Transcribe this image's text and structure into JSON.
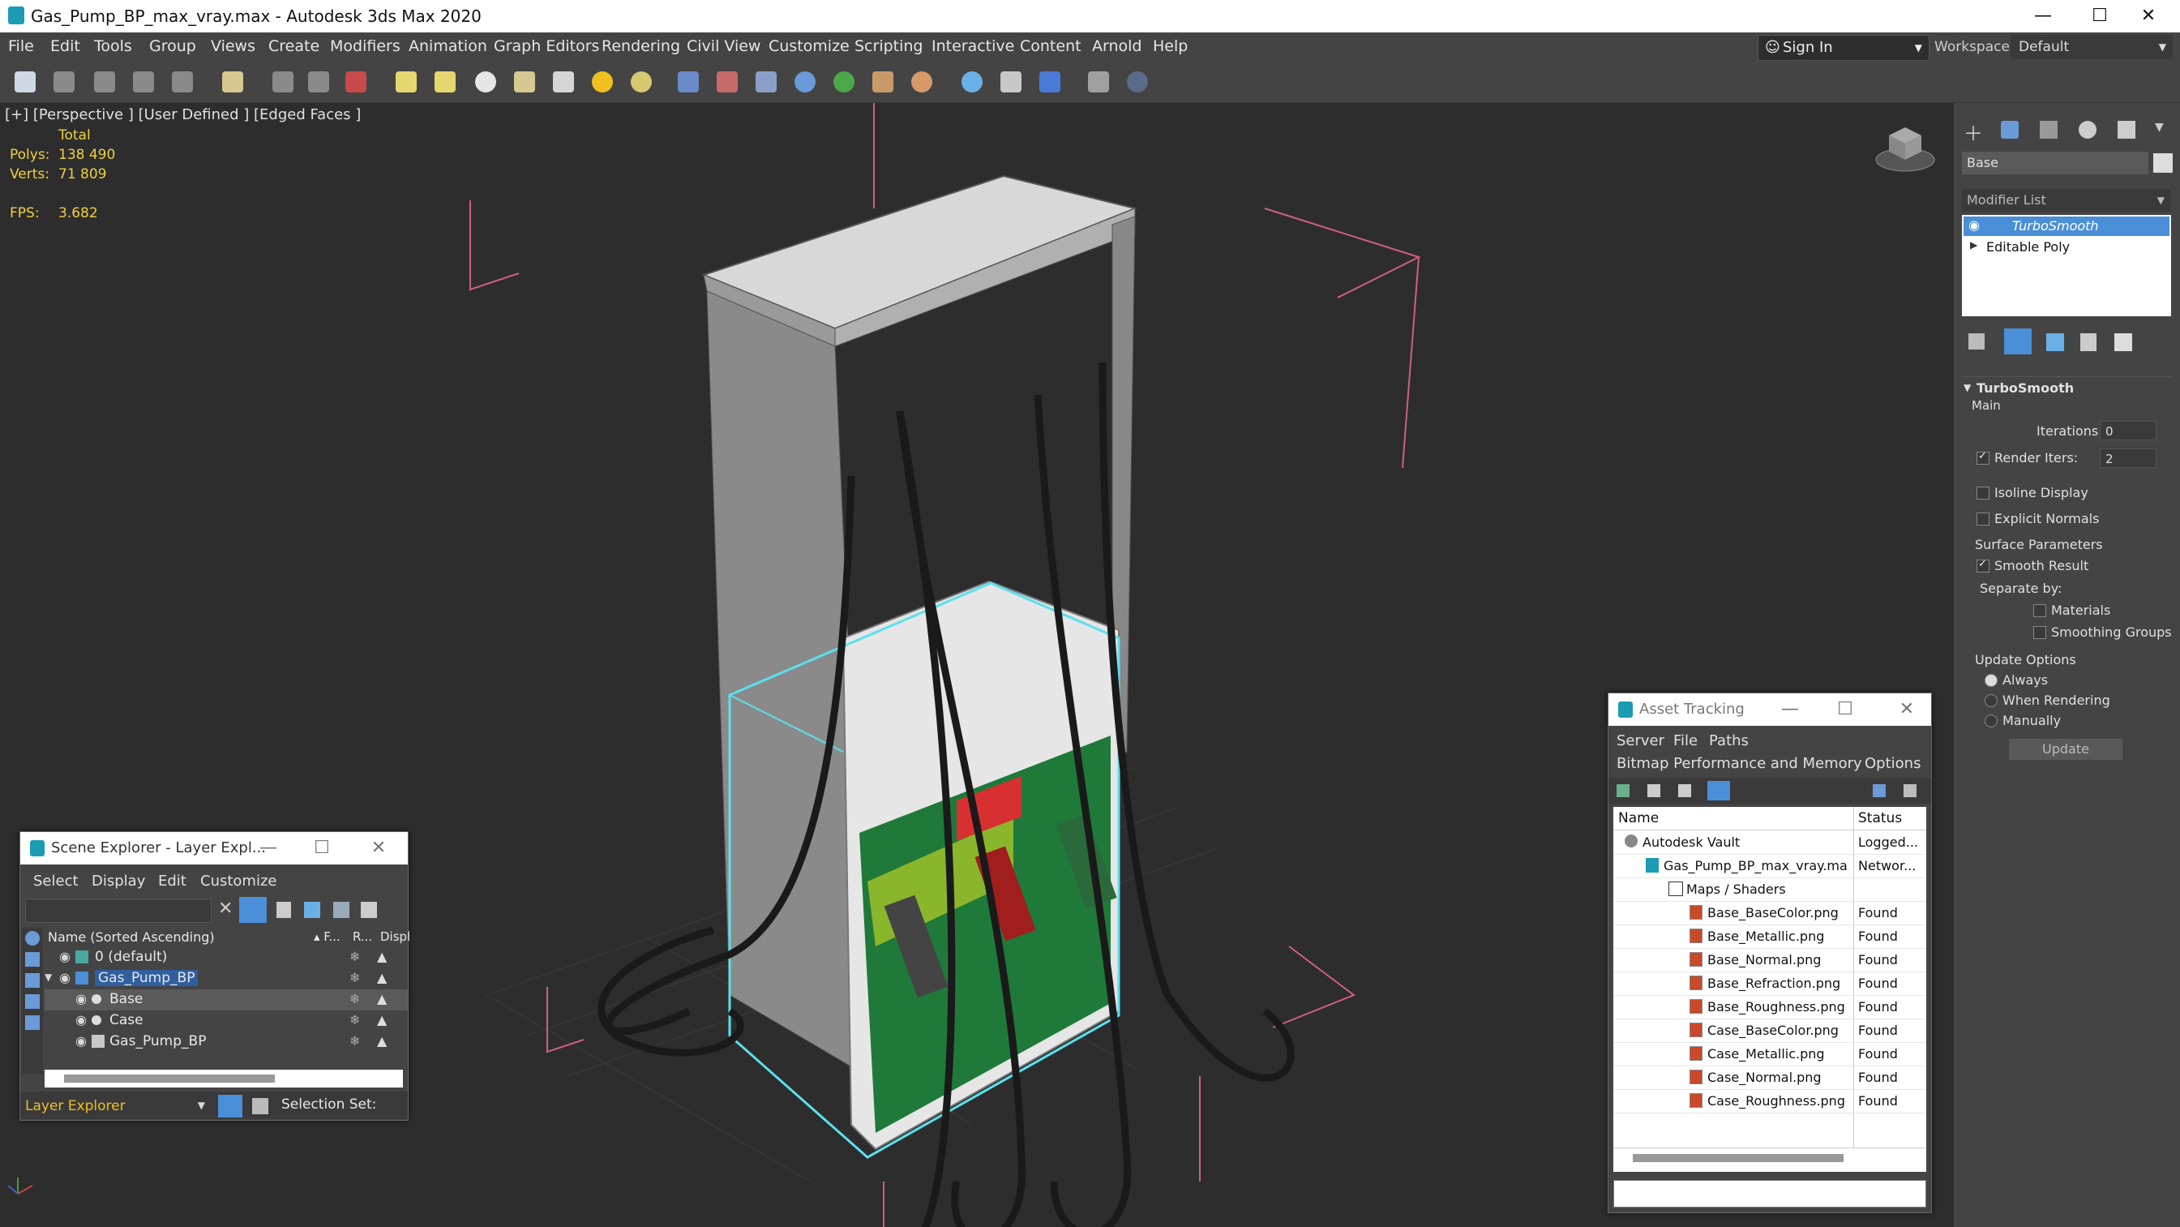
{
  "app": {
    "title": "Gas_Pump_BP_max_vray.max - Autodesk 3ds Max 2020"
  },
  "menu": [
    "File",
    "Edit",
    "Tools",
    "Group",
    "Views",
    "Create",
    "Modifiers",
    "Animation",
    "Graph Editors",
    "Rendering",
    "Civil View",
    "Customize",
    "Scripting",
    "Interactive",
    "Content",
    "Arnold",
    "Help"
  ],
  "account": {
    "sign_in": "Sign In",
    "workspaces_label": "Workspaces:",
    "workspace": "Default"
  },
  "viewport": {
    "label": "[+] [Perspective ] [User Defined ] [Edged Faces ]",
    "stats": {
      "total_label": "Total",
      "polys_label": "Polys:",
      "polys": "138 490",
      "verts_label": "Verts:",
      "verts": "71 809",
      "fps_label": "FPS:",
      "fps": "3.682"
    }
  },
  "command_panel": {
    "object_name": "Base",
    "modifier_list": "Modifier List",
    "stack": [
      "TurboSmooth",
      "Editable Poly"
    ],
    "turbosmooth": {
      "title": "TurboSmooth",
      "main": "Main",
      "iterations_label": "Iterations:",
      "iterations": "0",
      "render_iters_label": "Render Iters:",
      "render_iters": "2",
      "isoline": "Isoline Display",
      "explicit_normals": "Explicit Normals",
      "surface_params": "Surface Parameters",
      "smooth_result": "Smooth Result",
      "separate_by": "Separate by:",
      "materials": "Materials",
      "smoothing_groups": "Smoothing Groups",
      "update_options": "Update Options",
      "always": "Always",
      "when_rendering": "When Rendering",
      "manually": "Manually",
      "update_button": "Update"
    }
  },
  "scene_explorer": {
    "title": "Scene Explorer - Layer Expl...",
    "menu": [
      "Select",
      "Display",
      "Edit",
      "Customize"
    ],
    "col_name": "Name (Sorted Ascending)",
    "col_f": "▴ F...",
    "col_r": "R...",
    "col_d": "Displ",
    "rows": [
      {
        "label": "0 (default)"
      },
      {
        "label": "Gas_Pump_BP"
      },
      {
        "label": "Base"
      },
      {
        "label": "Case"
      },
      {
        "label": "Gas_Pump_BP"
      }
    ],
    "footer_mode": "Layer Explorer",
    "selection_set": "Selection Set:"
  },
  "asset_tracking": {
    "title": "Asset Tracking",
    "menu": [
      "Server",
      "File",
      "Paths"
    ],
    "menu2": [
      "Bitmap Performance and Memory",
      "Options"
    ],
    "col_name": "Name",
    "col_status": "Status",
    "rows": [
      {
        "name": "Autodesk Vault",
        "status": "Logged..."
      },
      {
        "name": "Gas_Pump_BP_max_vray.max",
        "status": "Networ..."
      },
      {
        "name": "Maps / Shaders",
        "status": ""
      },
      {
        "name": "Base_BaseColor.png",
        "status": "Found"
      },
      {
        "name": "Base_Metallic.png",
        "status": "Found"
      },
      {
        "name": "Base_Normal.png",
        "status": "Found"
      },
      {
        "name": "Base_Refraction.png",
        "status": "Found"
      },
      {
        "name": "Base_Roughness.png",
        "status": "Found"
      },
      {
        "name": "Case_BaseColor.png",
        "status": "Found"
      },
      {
        "name": "Case_Metallic.png",
        "status": "Found"
      },
      {
        "name": "Case_Normal.png",
        "status": "Found"
      },
      {
        "name": "Case_Roughness.png",
        "status": "Found"
      }
    ]
  },
  "colors": {
    "accent": "#4a8fd8",
    "selection_cyan": "#5ae0ee",
    "stats_yellow": "#f0d040",
    "bounding_pink": "#d06080"
  }
}
